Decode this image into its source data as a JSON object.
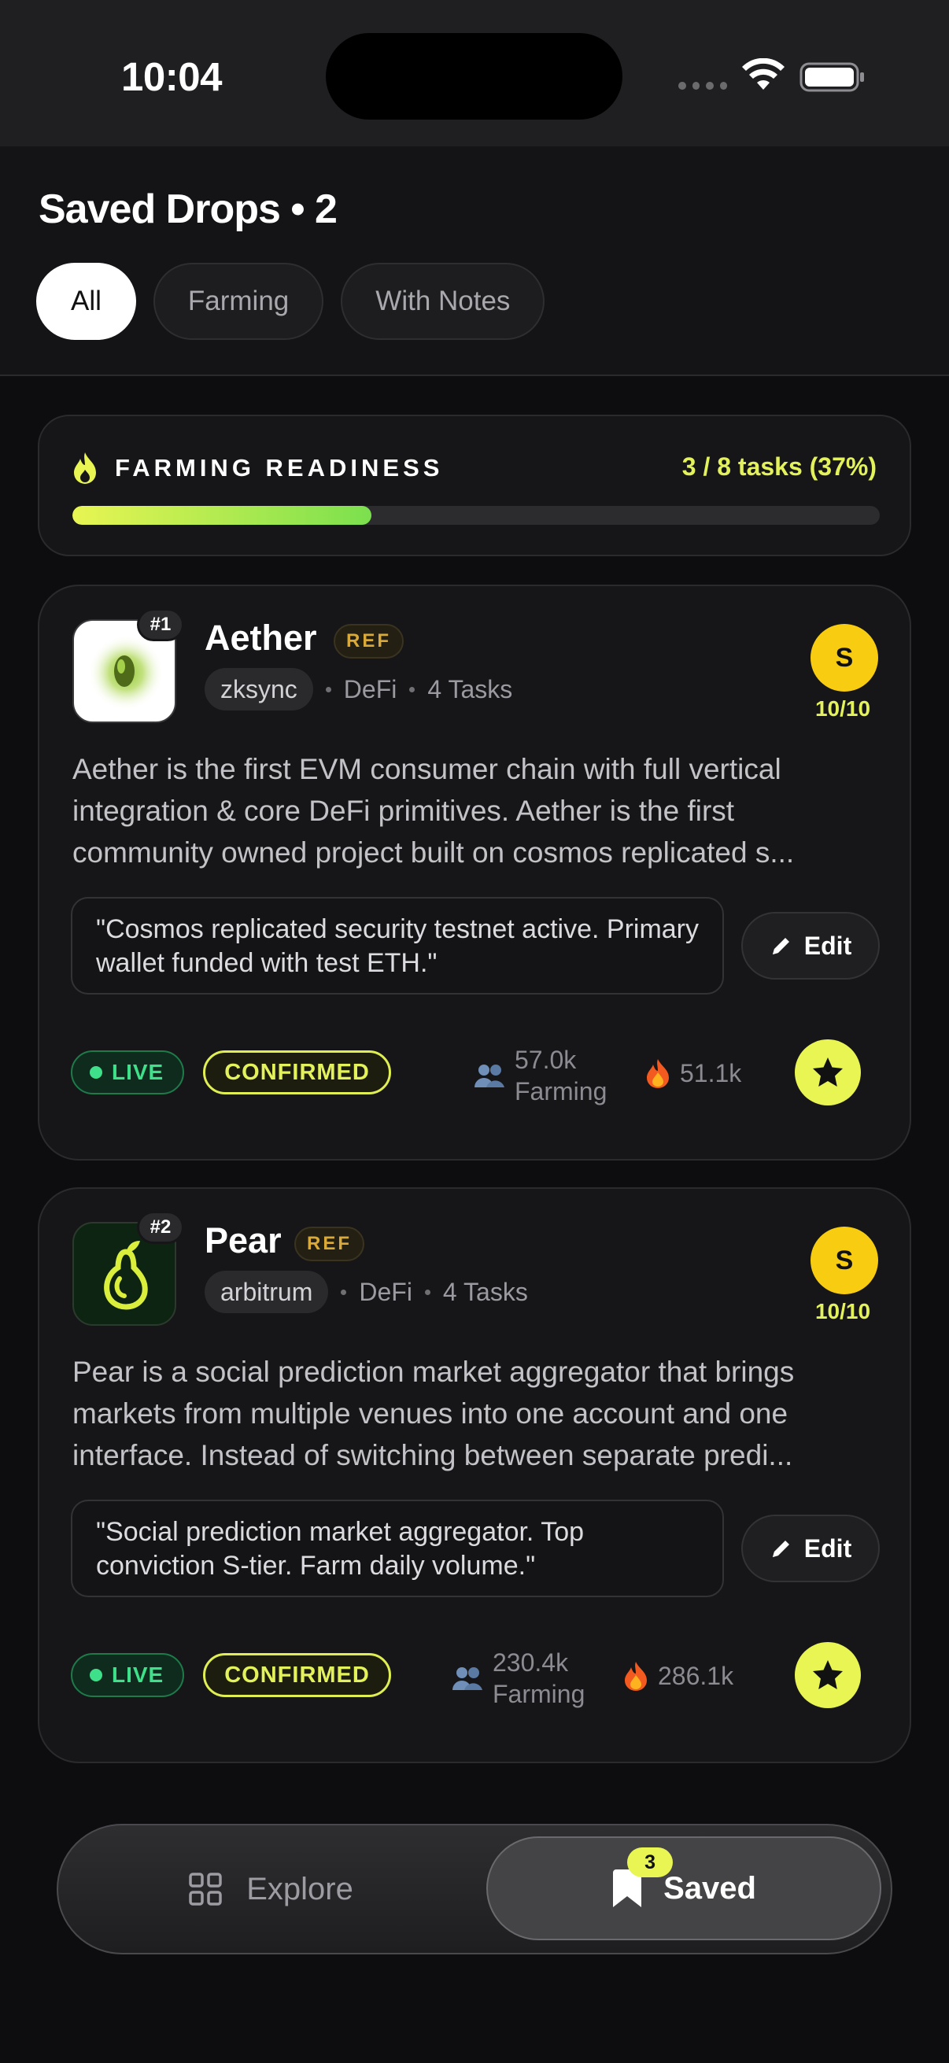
{
  "status_bar": {
    "time": "10:04"
  },
  "header": {
    "title": "Saved Drops • 2",
    "tabs": [
      "All",
      "Farming",
      "With Notes"
    ]
  },
  "readiness": {
    "title": "FARMING READINESS",
    "count": "3 / 8 tasks (37%)",
    "progress": 0.37
  },
  "drops": [
    {
      "rank": "#1",
      "name": "Aether",
      "ref": "REF",
      "chain": "zksync",
      "category": "DeFi",
      "tasks": "4 Tasks",
      "tier": "S",
      "score": "10/10",
      "description": "Aether is the first EVM consumer chain with full vertical integration & core DeFi primitives. Aether is the first community owned project built on cosmos replicated s...",
      "note": "\"Cosmos replicated security testnet active. Primary wallet funded with test ETH.\"",
      "edit_label": "Edit",
      "live_label": "LIVE",
      "confirmed_label": "CONFIRMED",
      "farmers": "57.0k",
      "farming_label": "Farming",
      "hot": "51.1k"
    },
    {
      "rank": "#2",
      "name": "Pear",
      "ref": "REF",
      "chain": "arbitrum",
      "category": "DeFi",
      "tasks": "4 Tasks",
      "tier": "S",
      "score": "10/10",
      "description": "Pear is a social prediction market aggregator that brings markets from multiple venues into one account and one interface. Instead of switching between separate predi...",
      "note": "\"Social prediction market aggregator. Top conviction S-tier. Farm daily volume.\"",
      "edit_label": "Edit",
      "live_label": "LIVE",
      "confirmed_label": "CONFIRMED",
      "farmers": "230.4k",
      "farming_label": "Farming",
      "hot": "286.1k"
    }
  ],
  "nav": {
    "explore": "Explore",
    "saved": "Saved",
    "saved_count": "3"
  },
  "colors": {
    "accent": "#e8f552",
    "tier": "#f7cc11",
    "live": "#3fe08a",
    "ref": "#d9a93a"
  }
}
